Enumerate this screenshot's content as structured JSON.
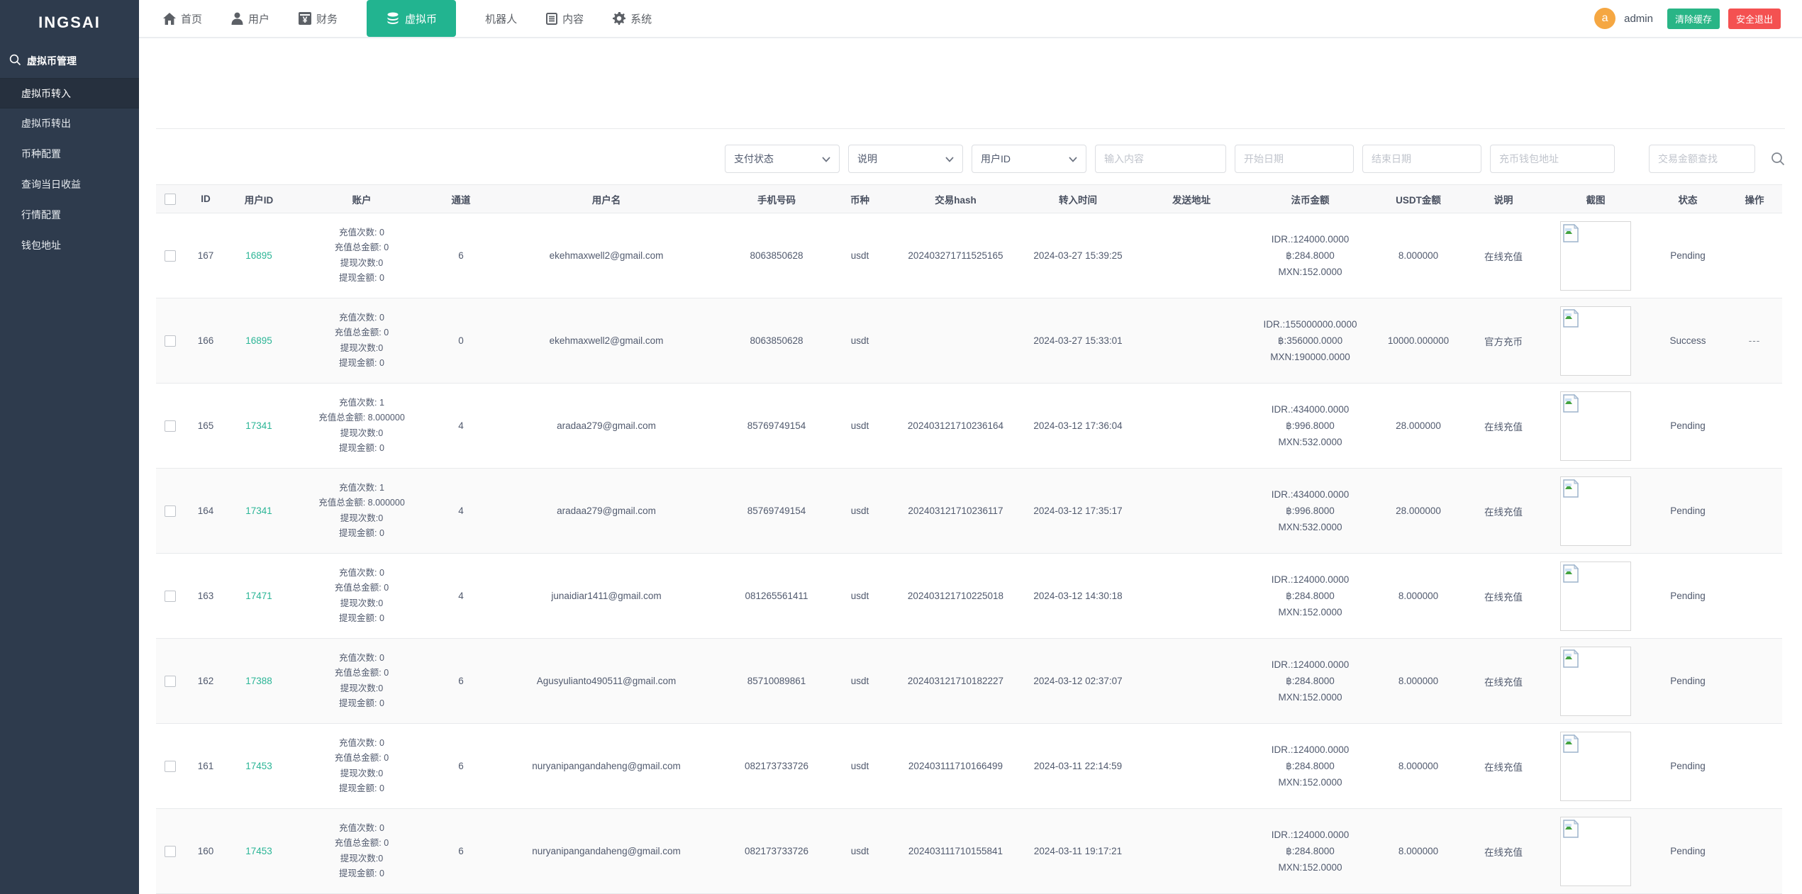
{
  "app": {
    "logo": "INGSAI"
  },
  "colors": {
    "accent_green": "#22b490",
    "danger_red": "#f45151",
    "avatar_orange": "#f5a742",
    "link_teal": "#2bb596",
    "sidebar_bg": "#2e3b4d"
  },
  "topnav": {
    "items": [
      {
        "label": "首页",
        "icon": "home-icon"
      },
      {
        "label": "用户",
        "icon": "user-icon"
      },
      {
        "label": "财务",
        "icon": "finance-yen-icon"
      },
      {
        "label": "虚拟币",
        "icon": "coins-icon",
        "active": true
      },
      {
        "label": "机器人",
        "icon": ""
      },
      {
        "label": "内容",
        "icon": "content-icon"
      },
      {
        "label": "系统",
        "icon": "gear-icon"
      }
    ],
    "user": {
      "avatar_letter": "a",
      "name": "admin"
    },
    "clear_cache_label": "清除缓存",
    "logout_label": "安全退出"
  },
  "sidebar": {
    "section": "虚拟币管理",
    "items": [
      {
        "label": "虚拟币转入",
        "active": true
      },
      {
        "label": "虚拟币转出",
        "active": false
      },
      {
        "label": "币种配置",
        "active": false
      },
      {
        "label": "查询当日收益",
        "active": false
      },
      {
        "label": "行情配置",
        "active": false
      },
      {
        "label": "钱包地址",
        "active": false
      }
    ]
  },
  "filters": {
    "selects": [
      {
        "label": "支付状态"
      },
      {
        "label": "说明"
      },
      {
        "label": "用户ID"
      }
    ],
    "inputs": [
      {
        "placeholder": "输入内容"
      },
      {
        "placeholder": "开始日期"
      },
      {
        "placeholder": "结束日期"
      },
      {
        "placeholder": "充币钱包地址"
      },
      {
        "placeholder": "交易金额查找"
      }
    ]
  },
  "table": {
    "columns": [
      "ID",
      "用户ID",
      "账户",
      "通道",
      "用户名",
      "手机号码",
      "币种",
      "交易hash",
      "转入时间",
      "发送地址",
      "法币金额",
      "USDT金额",
      "说明",
      "截图",
      "状态",
      "操作"
    ],
    "rows": [
      {
        "id": "167",
        "user_id": "16895",
        "account_lines": [
          "充值次数: 0",
          "充值总金额: 0",
          "提现次数:0",
          "提现金额: 0"
        ],
        "channel": "6",
        "username": "ekehmaxwell2@gmail.com",
        "phone": "8063850628",
        "coin": "usdt",
        "hash": "202403271711525165",
        "time": "2024-03-27 15:39:25",
        "send_address": "",
        "fiat_lines": [
          "IDR.:124000.0000",
          "฿:284.8000",
          "MXN:152.0000"
        ],
        "usdt": "8.000000",
        "note": "在线充值",
        "status": "Pending",
        "action": ""
      },
      {
        "id": "166",
        "user_id": "16895",
        "account_lines": [
          "充值次数: 0",
          "充值总金额: 0",
          "提现次数:0",
          "提现金额: 0"
        ],
        "channel": "0",
        "username": "ekehmaxwell2@gmail.com",
        "phone": "8063850628",
        "coin": "usdt",
        "hash": "",
        "time": "2024-03-27 15:33:01",
        "send_address": "",
        "fiat_lines": [
          "IDR.:155000000.0000",
          "฿:356000.0000",
          "MXN:190000.0000"
        ],
        "usdt": "10000.000000",
        "note": "官方充币",
        "status": "Success",
        "action": "---"
      },
      {
        "id": "165",
        "user_id": "17341",
        "account_lines": [
          "充值次数: 1",
          "充值总金额: 8.000000",
          "提现次数:0",
          "提现金额: 0"
        ],
        "channel": "4",
        "username": "aradaa279@gmail.com",
        "phone": "85769749154",
        "coin": "usdt",
        "hash": "202403121710236164",
        "time": "2024-03-12 17:36:04",
        "send_address": "",
        "fiat_lines": [
          "IDR.:434000.0000",
          "฿:996.8000",
          "MXN:532.0000"
        ],
        "usdt": "28.000000",
        "note": "在线充值",
        "status": "Pending",
        "action": ""
      },
      {
        "id": "164",
        "user_id": "17341",
        "account_lines": [
          "充值次数: 1",
          "充值总金额: 8.000000",
          "提现次数:0",
          "提现金额: 0"
        ],
        "channel": "4",
        "username": "aradaa279@gmail.com",
        "phone": "85769749154",
        "coin": "usdt",
        "hash": "202403121710236117",
        "time": "2024-03-12 17:35:17",
        "send_address": "",
        "fiat_lines": [
          "IDR.:434000.0000",
          "฿:996.8000",
          "MXN:532.0000"
        ],
        "usdt": "28.000000",
        "note": "在线充值",
        "status": "Pending",
        "action": ""
      },
      {
        "id": "163",
        "user_id": "17471",
        "account_lines": [
          "充值次数: 0",
          "充值总金额: 0",
          "提现次数:0",
          "提现金额: 0"
        ],
        "channel": "4",
        "username": "junaidiar1411@gmail.com",
        "phone": "081265561411",
        "coin": "usdt",
        "hash": "202403121710225018",
        "time": "2024-03-12 14:30:18",
        "send_address": "",
        "fiat_lines": [
          "IDR.:124000.0000",
          "฿:284.8000",
          "MXN:152.0000"
        ],
        "usdt": "8.000000",
        "note": "在线充值",
        "status": "Pending",
        "action": ""
      },
      {
        "id": "162",
        "user_id": "17388",
        "account_lines": [
          "充值次数: 0",
          "充值总金额: 0",
          "提现次数:0",
          "提现金额: 0"
        ],
        "channel": "6",
        "username": "Agusyulianto490511@gmail.com",
        "phone": "85710089861",
        "coin": "usdt",
        "hash": "202403121710182227",
        "time": "2024-03-12 02:37:07",
        "send_address": "",
        "fiat_lines": [
          "IDR.:124000.0000",
          "฿:284.8000",
          "MXN:152.0000"
        ],
        "usdt": "8.000000",
        "note": "在线充值",
        "status": "Pending",
        "action": ""
      },
      {
        "id": "161",
        "user_id": "17453",
        "account_lines": [
          "充值次数: 0",
          "充值总金额: 0",
          "提现次数:0",
          "提现金额: 0"
        ],
        "channel": "6",
        "username": "nuryanipangandaheng@gmail.com",
        "phone": "082173733726",
        "coin": "usdt",
        "hash": "202403111710166499",
        "time": "2024-03-11 22:14:59",
        "send_address": "",
        "fiat_lines": [
          "IDR.:124000.0000",
          "฿:284.8000",
          "MXN:152.0000"
        ],
        "usdt": "8.000000",
        "note": "在线充值",
        "status": "Pending",
        "action": ""
      },
      {
        "id": "160",
        "user_id": "17453",
        "account_lines": [
          "充值次数: 0",
          "充值总金额: 0",
          "提现次数:0",
          "提现金额: 0"
        ],
        "channel": "6",
        "username": "nuryanipangandaheng@gmail.com",
        "phone": "082173733726",
        "coin": "usdt",
        "hash": "202403111710155841",
        "time": "2024-03-11 19:17:21",
        "send_address": "",
        "fiat_lines": [
          "IDR.:124000.0000",
          "฿:284.8000",
          "MXN:152.0000"
        ],
        "usdt": "8.000000",
        "note": "在线充值",
        "status": "Pending",
        "action": ""
      }
    ]
  }
}
